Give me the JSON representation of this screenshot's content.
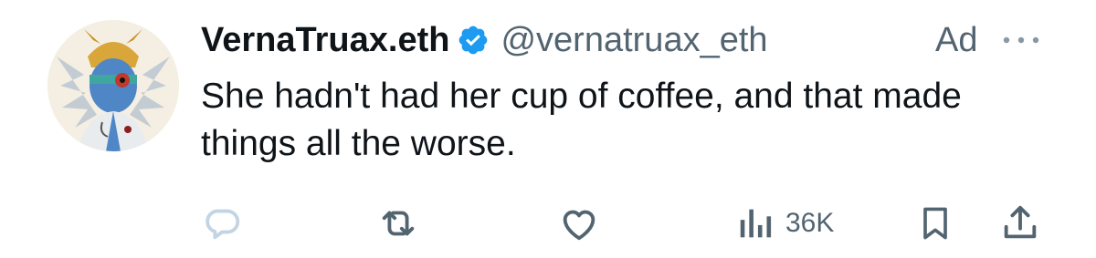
{
  "author": {
    "display_name": "VernaTruax.eth",
    "handle": "@vernatruax_eth",
    "verified_icon": "verified-badge-icon"
  },
  "ad_label": "Ad",
  "post": {
    "text": "She hadn't had her cup of coffee, and that made things all the worse."
  },
  "actions": {
    "views_count": "36K"
  },
  "colors": {
    "text": "#0f1419",
    "secondary": "#536471",
    "verified": "#1d9bf0",
    "reply_icon": "#c3d4e2"
  },
  "icons": {
    "more": "more-dots-icon",
    "reply": "reply-icon",
    "repost": "repost-icon",
    "like": "heart-icon",
    "views": "views-bar-chart-icon",
    "bookmark": "bookmark-icon",
    "share": "share-icon"
  }
}
